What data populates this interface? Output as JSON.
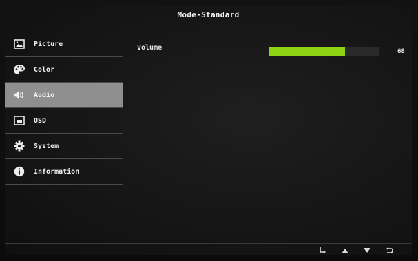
{
  "title": "Mode-Standard",
  "menu": [
    {
      "label": "Picture",
      "icon": "picture-icon",
      "active": false
    },
    {
      "label": "Color",
      "icon": "palette-icon",
      "active": false
    },
    {
      "label": "Audio",
      "icon": "speaker-icon",
      "active": true
    },
    {
      "label": "OSD",
      "icon": "osd-window-icon",
      "active": false
    },
    {
      "label": "System",
      "icon": "gear-icon",
      "active": false
    },
    {
      "label": "Information",
      "icon": "info-icon",
      "active": false
    }
  ],
  "settings": {
    "volume_label": "Volume",
    "volume_value": "68",
    "volume_level": 0.69
  },
  "colors": {
    "accent": "#8ed414",
    "active_row": "#8f8f8f"
  },
  "nav_keys": [
    "enter-icon",
    "up-arrow-icon",
    "down-arrow-icon",
    "return-icon"
  ]
}
